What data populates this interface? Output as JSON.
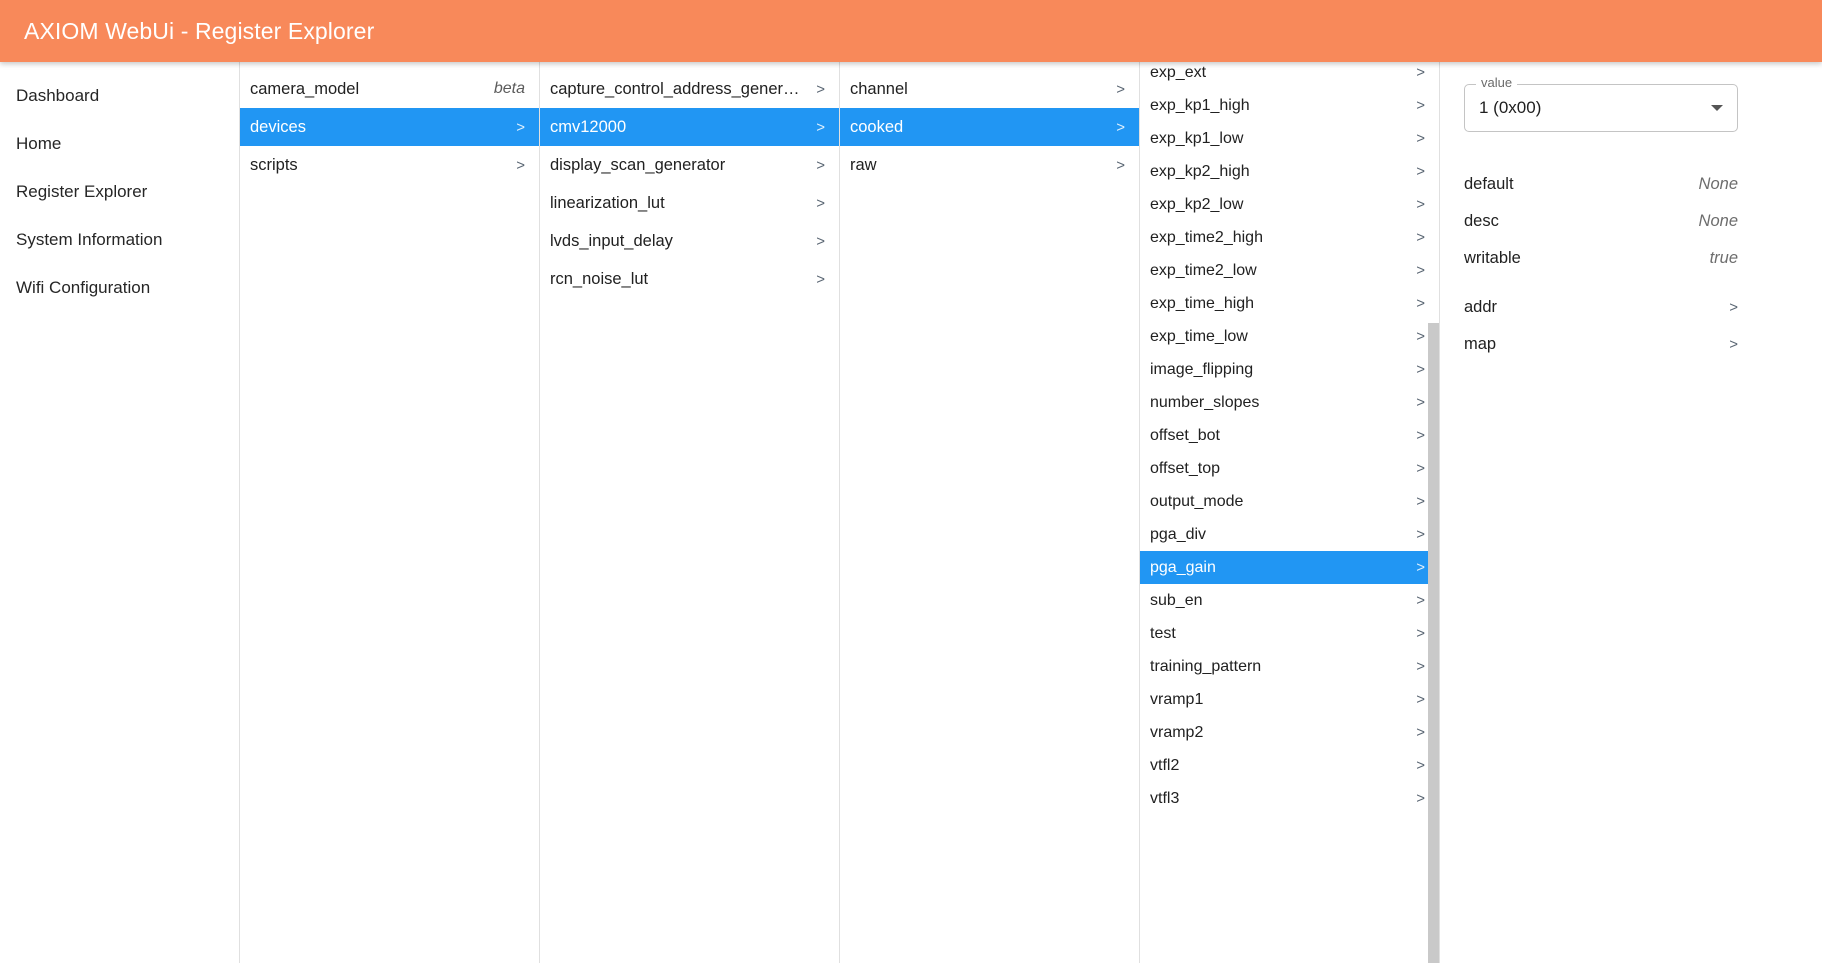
{
  "header": {
    "title": "AXIOM WebUi - Register Explorer"
  },
  "sidebar": {
    "items": [
      {
        "label": "Dashboard"
      },
      {
        "label": "Home"
      },
      {
        "label": "Register Explorer"
      },
      {
        "label": "System Information"
      },
      {
        "label": "Wifi Configuration"
      }
    ]
  },
  "columns": [
    {
      "name": "root-column",
      "rows": [
        {
          "label": "camera_model",
          "badge": "beta",
          "chevron": false,
          "selected": false
        },
        {
          "label": "devices",
          "chevron": true,
          "selected": true
        },
        {
          "label": "scripts",
          "chevron": true,
          "selected": false
        }
      ]
    },
    {
      "name": "devices-column",
      "rows": [
        {
          "label": "capture_control_address_generator",
          "chevron": true,
          "selected": false
        },
        {
          "label": "cmv12000",
          "chevron": true,
          "selected": true
        },
        {
          "label": "display_scan_generator",
          "chevron": true,
          "selected": false
        },
        {
          "label": "linearization_lut",
          "chevron": true,
          "selected": false
        },
        {
          "label": "lvds_input_delay",
          "chevron": true,
          "selected": false
        },
        {
          "label": "rcn_noise_lut",
          "chevron": true,
          "selected": false
        }
      ]
    },
    {
      "name": "cmv12000-column",
      "rows": [
        {
          "label": "channel",
          "chevron": true,
          "selected": false
        },
        {
          "label": "cooked",
          "chevron": true,
          "selected": true
        },
        {
          "label": "raw",
          "chevron": true,
          "selected": false
        }
      ]
    },
    {
      "name": "cooked-registers-column",
      "rows": [
        {
          "label": "exp_ext",
          "chevron": true,
          "selected": false
        },
        {
          "label": "exp_kp1_high",
          "chevron": true,
          "selected": false
        },
        {
          "label": "exp_kp1_low",
          "chevron": true,
          "selected": false
        },
        {
          "label": "exp_kp2_high",
          "chevron": true,
          "selected": false
        },
        {
          "label": "exp_kp2_low",
          "chevron": true,
          "selected": false
        },
        {
          "label": "exp_time2_high",
          "chevron": true,
          "selected": false
        },
        {
          "label": "exp_time2_low",
          "chevron": true,
          "selected": false
        },
        {
          "label": "exp_time_high",
          "chevron": true,
          "selected": false
        },
        {
          "label": "exp_time_low",
          "chevron": true,
          "selected": false
        },
        {
          "label": "image_flipping",
          "chevron": true,
          "selected": false
        },
        {
          "label": "number_slopes",
          "chevron": true,
          "selected": false
        },
        {
          "label": "offset_bot",
          "chevron": true,
          "selected": false
        },
        {
          "label": "offset_top",
          "chevron": true,
          "selected": false
        },
        {
          "label": "output_mode",
          "chevron": true,
          "selected": false
        },
        {
          "label": "pga_div",
          "chevron": true,
          "selected": false
        },
        {
          "label": "pga_gain",
          "chevron": true,
          "selected": true
        },
        {
          "label": "sub_en",
          "chevron": true,
          "selected": false
        },
        {
          "label": "test",
          "chevron": true,
          "selected": false
        },
        {
          "label": "training_pattern",
          "chevron": true,
          "selected": false
        },
        {
          "label": "vramp1",
          "chevron": true,
          "selected": false
        },
        {
          "label": "vramp2",
          "chevron": true,
          "selected": false
        },
        {
          "label": "vtfl2",
          "chevron": true,
          "selected": false
        },
        {
          "label": "vtfl3",
          "chevron": true,
          "selected": false
        }
      ]
    }
  ],
  "detail": {
    "value_field": {
      "legend": "value",
      "value": "1 (0x00)",
      "arrow_icon": "chevron-down-icon"
    },
    "properties": [
      {
        "key": "default",
        "value": "None"
      },
      {
        "key": "desc",
        "value": "None"
      },
      {
        "key": "writable",
        "value": "true"
      }
    ],
    "nav_rows": [
      {
        "label": "addr",
        "chevron": ">"
      },
      {
        "label": "map",
        "chevron": ">"
      }
    ]
  },
  "icons": {
    "chevron_right": ">"
  },
  "colors": {
    "header_orange": "#f8895a",
    "selection_blue": "#2196f3",
    "divider_grey": "#e0e0e0",
    "scrollbar_thumb": "#c9c9c9"
  }
}
